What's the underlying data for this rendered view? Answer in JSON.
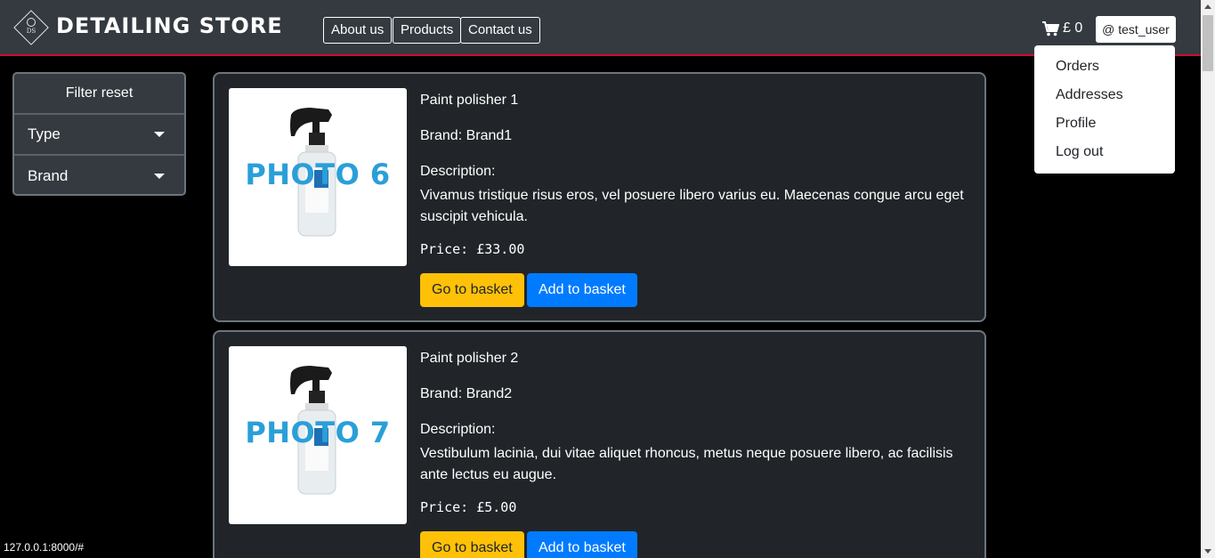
{
  "brand": {
    "name": "DETAILING STORE",
    "mark": "DS",
    "icon": "sun-diamond-logo"
  },
  "nav": {
    "links": [
      "About us",
      "Products",
      "Contact us"
    ]
  },
  "cart": {
    "icon": "cart-icon",
    "amount": "£ 0"
  },
  "user": {
    "label": "@ test_user"
  },
  "user_menu": {
    "items": [
      "Orders",
      "Addresses",
      "Profile",
      "Log out"
    ]
  },
  "filter": {
    "reset_label": "Filter reset",
    "type_label": "Type",
    "brand_label": "Brand"
  },
  "products": [
    {
      "photo_label": "PHOTO 6",
      "name": "Paint polisher 1",
      "brand": "Brand: Brand1",
      "desc_label": "Description:",
      "description": "Vivamus tristique risus eros, vel posuere libero varius eu. Maecenas congue arcu eget suscipit vehicula.",
      "price": "Price: £33.00",
      "go_label": "Go to basket",
      "add_label": "Add to basket"
    },
    {
      "photo_label": "PHOTO 7",
      "name": "Paint polisher 2",
      "brand": "Brand: Brand2",
      "desc_label": "Description:",
      "description": "Vestibulum lacinia, dui vitae aliquet rhoncus, metus neque posuere libero, ac facilisis ante lectus eu augue.",
      "price": "Price: £5.00",
      "go_label": "Go to basket",
      "add_label": "Add to basket"
    }
  ],
  "status_bar": {
    "url": "127.0.0.1:8000/#"
  },
  "colors": {
    "navbar": "#343a40",
    "accent_line": "#c8102e",
    "warning": "#ffc107",
    "primary": "#007bff",
    "card": "#212529"
  }
}
